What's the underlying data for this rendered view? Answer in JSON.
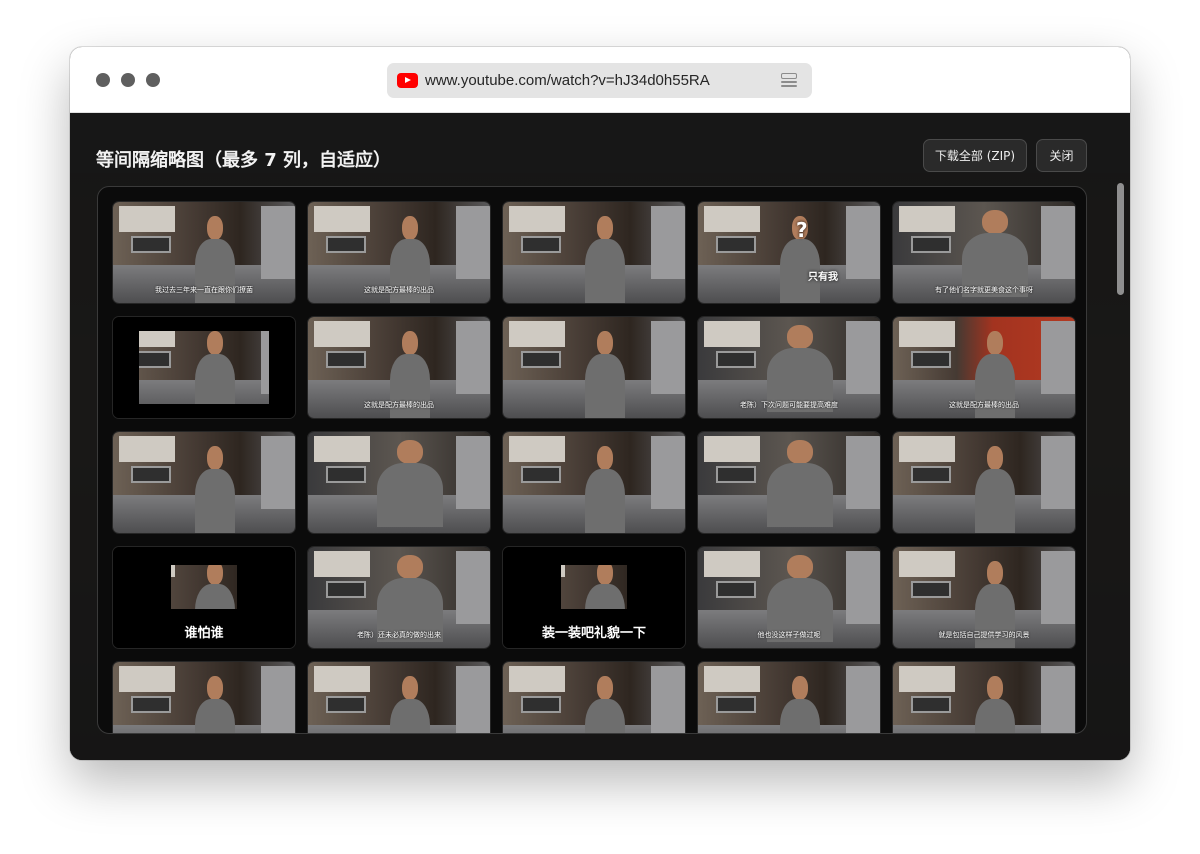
{
  "browser": {
    "url": "www.youtube.com/watch?v=hJ34d0h55RA",
    "favicon": "youtube-icon",
    "reader_icon": "reader-view-icon"
  },
  "panel": {
    "title": "等间隔缩略图（最多 7 列，自适应）",
    "download_label": "下载全部 (ZIP)",
    "close_label": "关闭"
  },
  "thumbnails": [
    {
      "caption": "我过去三年来一直在跟你们撩菌",
      "style": "kitchen"
    },
    {
      "caption": "这就是配方最棒的出品",
      "style": "kitchen"
    },
    {
      "caption": "",
      "style": "kitchen"
    },
    {
      "caption": "",
      "style": "kitchen",
      "overlay_text": "?",
      "tag": "只有我"
    },
    {
      "caption": "有了他们名字就更美食这个事呀",
      "style": "closeup"
    },
    {
      "caption": "",
      "style": "letterbox"
    },
    {
      "caption": "这就是配方最棒的出品",
      "style": "kitchen"
    },
    {
      "caption": "",
      "style": "kitchen"
    },
    {
      "caption": "老陈）下次问题可能要提高难度",
      "style": "closeup"
    },
    {
      "caption": "这就是配方最棒的出品",
      "style": "red-kitchen"
    },
    {
      "caption": "",
      "style": "kitchen"
    },
    {
      "caption": "",
      "style": "closeup"
    },
    {
      "caption": "",
      "style": "kitchen"
    },
    {
      "caption": "",
      "style": "closeup"
    },
    {
      "caption": "",
      "style": "kitchen"
    },
    {
      "caption": "谁怕谁",
      "style": "letterbox-small"
    },
    {
      "caption": "老陈）还未必真的做的出来",
      "style": "closeup"
    },
    {
      "caption": "装一装吧礼貌一下",
      "style": "letterbox-small"
    },
    {
      "caption": "他也没这样子做过呢",
      "style": "closeup"
    },
    {
      "caption": "就是包括自己提供学习的风景",
      "style": "kitchen"
    },
    {
      "caption": "",
      "style": "kitchen"
    },
    {
      "caption": "",
      "style": "kitchen"
    },
    {
      "caption": "",
      "style": "kitchen"
    },
    {
      "caption": "",
      "style": "kitchen"
    },
    {
      "caption": "",
      "style": "kitchen"
    }
  ],
  "colors": {
    "overlay_bg": "#141414",
    "panel_text": "#f2f2f2",
    "youtube_red": "#ff0000"
  }
}
